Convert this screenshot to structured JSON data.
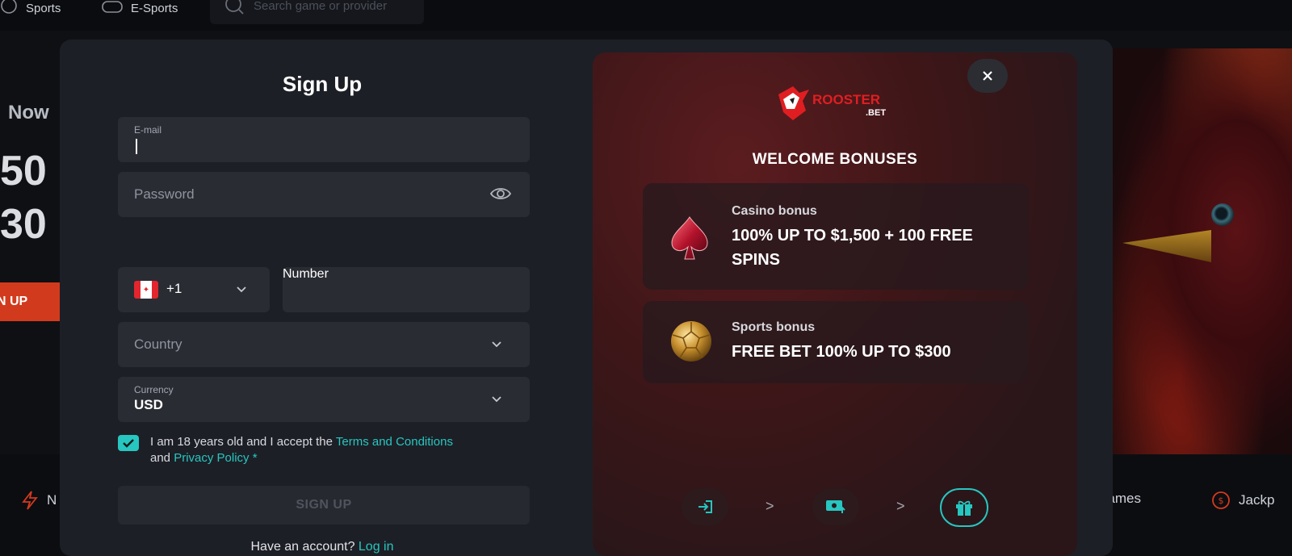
{
  "top_nav": {
    "items": [
      {
        "label": "Sports",
        "icon": "ball-icon"
      },
      {
        "label": "E-Sports",
        "icon": "gamepad-icon"
      }
    ],
    "search_placeholder": "Search game or provider"
  },
  "background": {
    "hero_now": "Now",
    "hero_line1": "50",
    "hero_line2": "30",
    "signup_label": "N UP",
    "bottom_items": [
      {
        "label": "N",
        "icon": "bolt-icon"
      },
      {
        "label": "e Games",
        "icon": "cards-icon"
      },
      {
        "label": "Jackp",
        "icon": "coin-icon"
      }
    ]
  },
  "signup_form": {
    "title": "Sign Up",
    "email_label": "E-mail",
    "email_value": "",
    "password_placeholder": "Password",
    "phone_code": "+1",
    "phone_placeholder": "Number",
    "country_placeholder": "Country",
    "currency_label": "Currency",
    "currency_value": "USD",
    "consent_prefix": "I am 18 years old and I accept the ",
    "terms_link": "Terms and Conditions",
    "consent_and": "and ",
    "privacy_link": "Privacy Policy",
    "required_mark": " *",
    "terms_checked": true,
    "submit_label": "SIGN UP",
    "have_account": "Have an account? ",
    "login_link": "Log in",
    "accent_color": "#27c6c0"
  },
  "promo": {
    "brand_top": "ROOSTER",
    "brand_bottom": ".BET",
    "heading": "WELCOME BONUSES",
    "bonuses": [
      {
        "category": "Casino bonus",
        "headline": "100% UP TO $1,500 + 100 FREE SPINS",
        "icon": "spade-icon"
      },
      {
        "category": "Sports bonus",
        "headline": "FREE BET 100% UP TO $300",
        "icon": "soccer-ball-icon"
      }
    ],
    "steps": [
      {
        "icon": "login-icon",
        "active": false
      },
      {
        "icon": "deposit-icon",
        "active": false
      },
      {
        "icon": "gift-icon",
        "active": true
      }
    ],
    "step_separator": ">"
  },
  "close_label": "×"
}
